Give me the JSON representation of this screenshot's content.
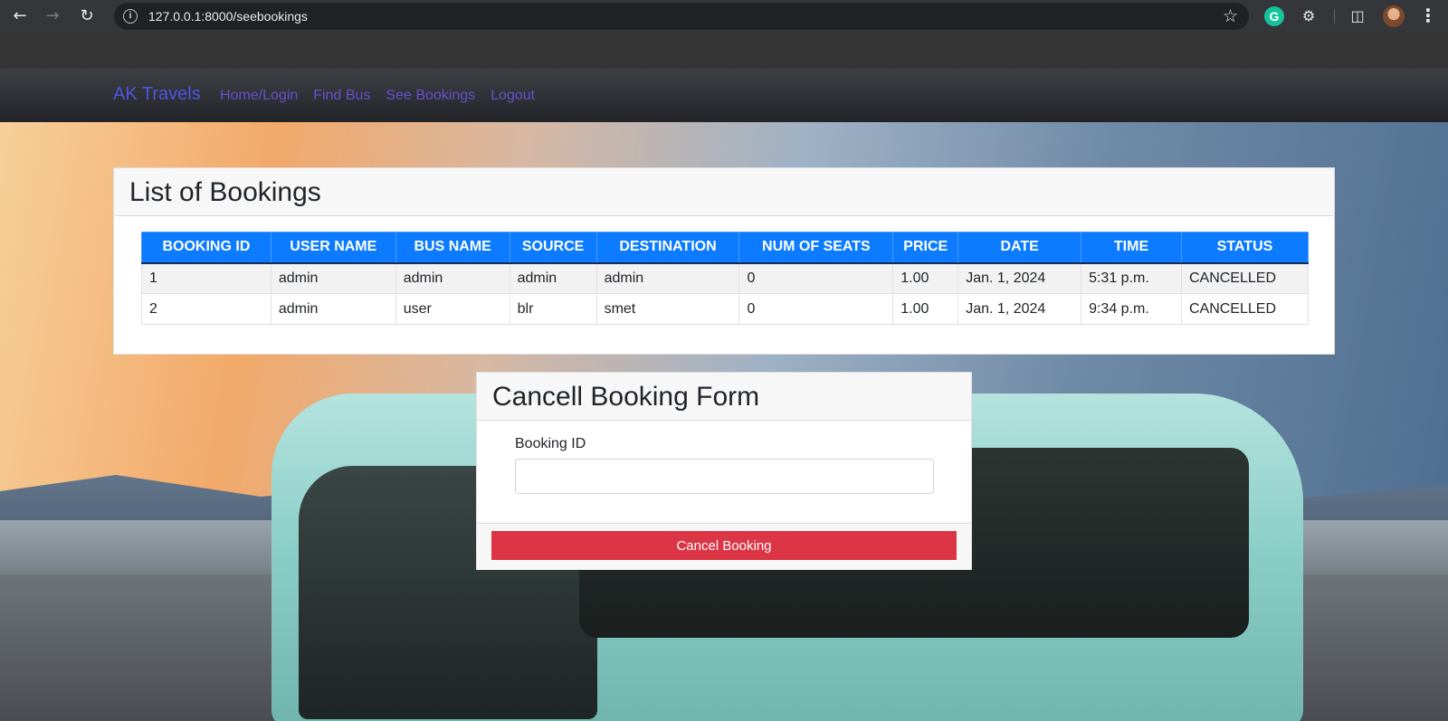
{
  "browser": {
    "url": "127.0.0.1:8000/seebookings",
    "grammarly_letter": "G",
    "icons": [
      "back-icon",
      "forward-icon",
      "reload-icon",
      "info-icon",
      "star-icon",
      "grammarly-icon",
      "extensions-icon",
      "side-panel-icon",
      "profile-avatar",
      "menu-icon"
    ]
  },
  "navbar": {
    "brand": "AK Travels",
    "links": [
      "Home/Login",
      "Find Bus",
      "See Bookings",
      "Logout"
    ]
  },
  "bookings": {
    "title": "List of Bookings",
    "columns": [
      "BOOKING ID",
      "USER NAME",
      "BUS NAME",
      "SOURCE",
      "DESTINATION",
      "NUM OF SEATS",
      "PRICE",
      "DATE",
      "TIME",
      "STATUS"
    ],
    "rows": [
      [
        "1",
        "admin",
        "admin",
        "admin",
        "admin",
        "0",
        "1.00",
        "Jan. 1, 2024",
        "5:31 p.m.",
        "CANCELLED"
      ],
      [
        "2",
        "admin",
        "user",
        "blr",
        "smet",
        "0",
        "1.00",
        "Jan. 1, 2024",
        "9:34 p.m.",
        "CANCELLED"
      ]
    ]
  },
  "cancel_form": {
    "title": "Cancell Booking Form",
    "booking_id_label": "Booking ID",
    "booking_id_value": "",
    "submit_label": "Cancel Booking"
  },
  "colors": {
    "brand": "#4e56e3",
    "nav_link": "#6a4fcf",
    "table_header": "#0d7bff",
    "danger": "#dc3545"
  }
}
